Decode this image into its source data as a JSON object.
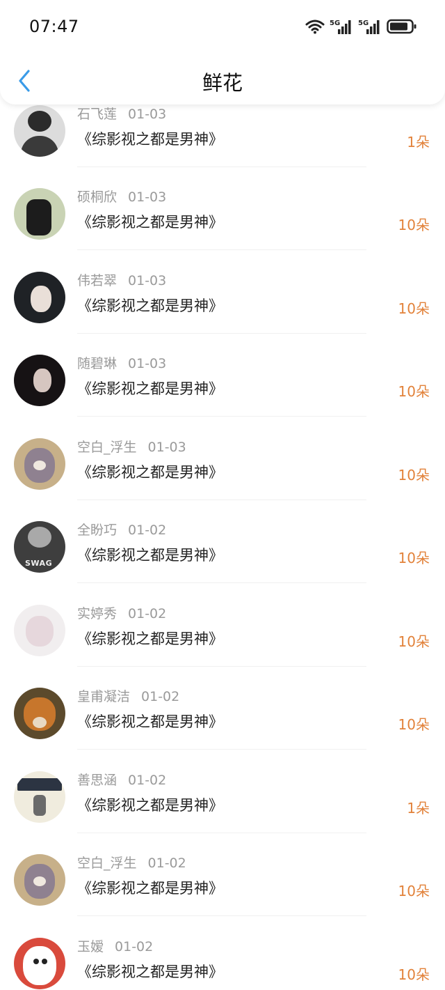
{
  "status_bar": {
    "time": "07:47",
    "icons": [
      "wifi-icon",
      "signal-5g-icon",
      "signal-5g-icon",
      "battery-icon"
    ],
    "signal_label": "5G"
  },
  "header": {
    "title": "鲜花",
    "back_icon": "chevron-left-icon",
    "accent": "#3a9be8"
  },
  "count_color": "#e2823a",
  "items": [
    {
      "name": "石飞莲",
      "date": "01-03",
      "title": "《综影视之都是男神》",
      "count": "1朵"
    },
    {
      "name": "硕桐欣",
      "date": "01-03",
      "title": "《综影视之都是男神》",
      "count": "10朵"
    },
    {
      "name": "伟若翠",
      "date": "01-03",
      "title": "《综影视之都是男神》",
      "count": "10朵"
    },
    {
      "name": "随碧琳",
      "date": "01-03",
      "title": "《综影视之都是男神》",
      "count": "10朵"
    },
    {
      "name": "空白_浮生",
      "date": "01-03",
      "title": "《综影视之都是男神》",
      "count": "10朵"
    },
    {
      "name": "全盼巧",
      "date": "01-02",
      "title": "《综影视之都是男神》",
      "count": "10朵",
      "avatar_text": "SWAG"
    },
    {
      "name": "实婷秀",
      "date": "01-02",
      "title": "《综影视之都是男神》",
      "count": "10朵"
    },
    {
      "name": "皇甫凝洁",
      "date": "01-02",
      "title": "《综影视之都是男神》",
      "count": "10朵"
    },
    {
      "name": "善思涵",
      "date": "01-02",
      "title": "《综影视之都是男神》",
      "count": "1朵"
    },
    {
      "name": "空白_浮生",
      "date": "01-02",
      "title": "《综影视之都是男神》",
      "count": "10朵"
    },
    {
      "name": "玉嫒",
      "date": "01-02",
      "title": "《综影视之都是男神》",
      "count": "10朵"
    }
  ]
}
